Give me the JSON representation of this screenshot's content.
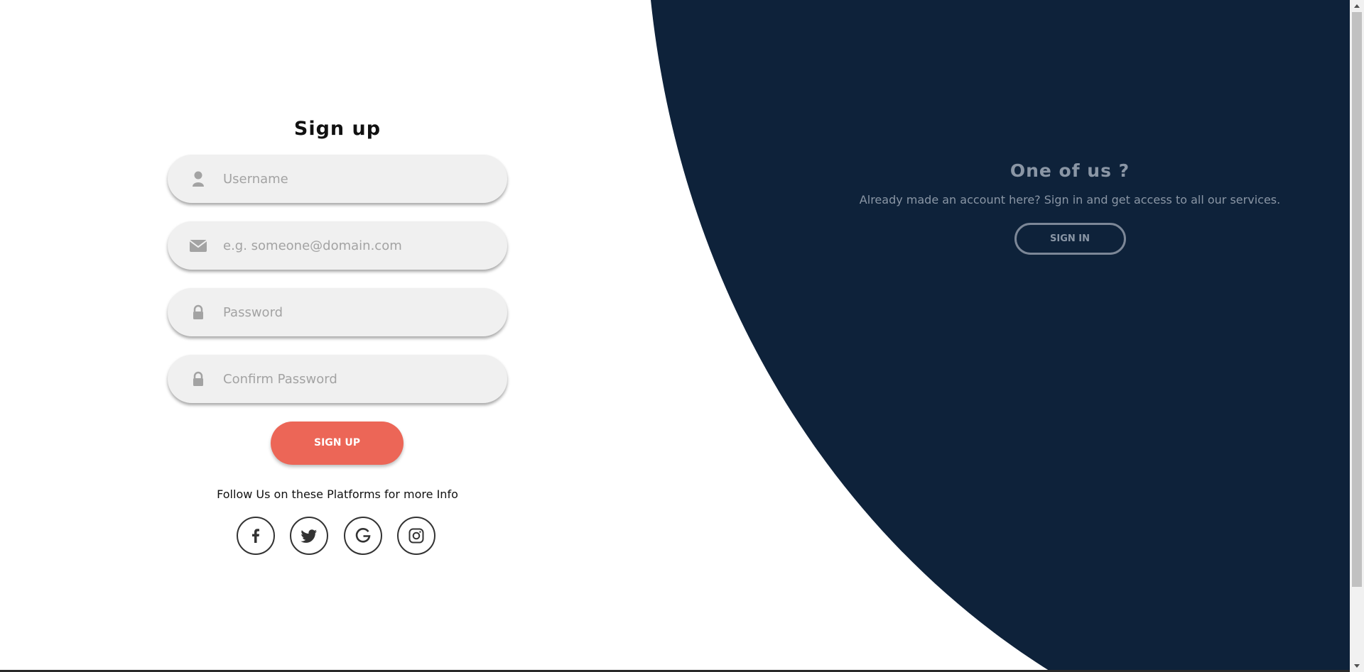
{
  "colors": {
    "navy": "#0e223a",
    "accent": "#ec6657",
    "field_bg": "#f0f0f0",
    "muted_text": "#8a96a5"
  },
  "signup": {
    "title": "Sign up",
    "fields": [
      {
        "icon": "user-icon",
        "placeholder": "Username",
        "value": ""
      },
      {
        "icon": "envelope-icon",
        "placeholder": "e.g. someone@domain.com",
        "value": ""
      },
      {
        "icon": "lock-icon",
        "placeholder": "Password",
        "value": ""
      },
      {
        "icon": "lock-icon",
        "placeholder": "Confirm Password",
        "value": ""
      }
    ],
    "button_label": "SIGN UP",
    "follow_text": "Follow Us on these Platforms for more Info",
    "social": [
      {
        "icon": "facebook-icon"
      },
      {
        "icon": "twitter-icon"
      },
      {
        "icon": "google-icon"
      },
      {
        "icon": "instagram-icon"
      }
    ]
  },
  "signin_panel": {
    "title": "One of us ?",
    "text": "Already made an account here? Sign in and get access to all our services.",
    "button_label": "SIGN IN"
  }
}
